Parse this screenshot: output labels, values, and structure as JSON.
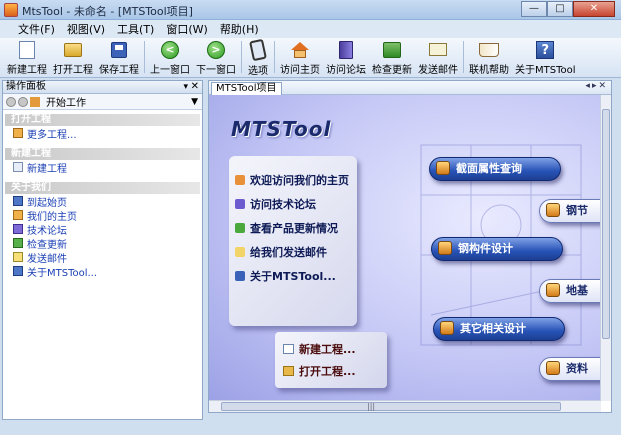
{
  "window": {
    "title": "MtsTool - 未命名 - [MTSTool项目]",
    "minimize": "—",
    "maximize": "□",
    "close": "✕"
  },
  "menu": [
    "文件(F)",
    "视图(V)",
    "工具(T)",
    "窗口(W)",
    "帮助(H)"
  ],
  "toolbar": {
    "new_project": "新建工程",
    "open_project": "打开工程",
    "save_project": "保存工程",
    "prev_window": "上一窗口",
    "next_window": "下一窗口",
    "options": "选项",
    "visit_home": "访问主页",
    "visit_forum": "访问论坛",
    "check_update": "检查更新",
    "send_mail": "发送邮件",
    "online_help": "联机帮助",
    "about": "关于MTSTool"
  },
  "left_panel": {
    "title": "操作面板",
    "nav_title": "开始工作",
    "sections": {
      "open": {
        "title": "打开工程",
        "items": [
          "更多工程..."
        ]
      },
      "new": {
        "title": "新建工程",
        "items": [
          "新建工程"
        ]
      },
      "about": {
        "title": "关于我们",
        "items": [
          "到起始页",
          "我们的主页",
          "技术论坛",
          "检查更新",
          "发送邮件",
          "关于MTSTool..."
        ]
      }
    }
  },
  "document": {
    "tab": "MTSTool项目",
    "brand": "MTSTool",
    "links": [
      "欢迎访问我们的主页",
      "访问技术论坛",
      "查看产品更新情况",
      "给我们发送邮件",
      "关于MTSTool..."
    ],
    "project_links": [
      "新建工程...",
      "打开工程..."
    ],
    "modules": [
      "截面属性查询",
      "钢节",
      "钢构件设计",
      "地基",
      "其它相关设计",
      "资料"
    ]
  },
  "colors": {
    "accent": "#2752b6",
    "canvas": "#c4c7f5",
    "link": "#1a3fb4"
  }
}
